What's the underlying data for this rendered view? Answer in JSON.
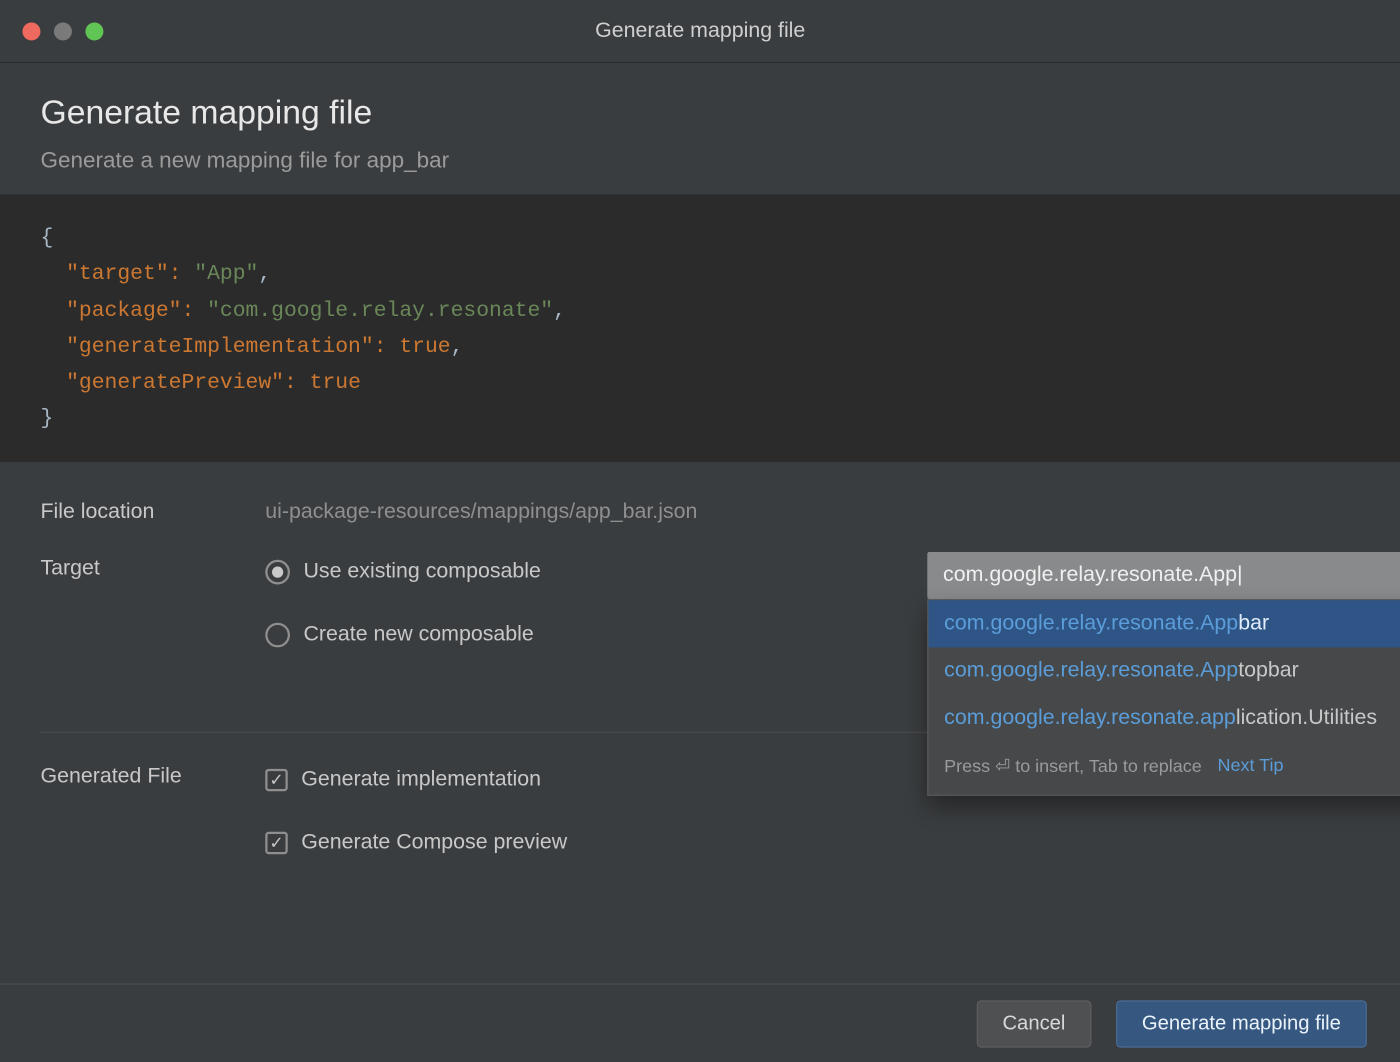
{
  "titlebar": {
    "title": "Generate mapping file"
  },
  "header": {
    "title": "Generate mapping file",
    "subtitle": "Generate a new mapping file for app_bar"
  },
  "code": {
    "open": "{",
    "indent": "  ",
    "k_target": "\"target\"",
    "v_target": "\"App\"",
    "k_package": "\"package\"",
    "v_package": "\"com.google.relay.resonate\"",
    "k_genImpl": "\"generateImplementation\"",
    "v_true1": "true",
    "k_genPrev": "\"generatePreview\"",
    "v_true2": "true",
    "close": "}",
    "comma": ",",
    "colon": ":"
  },
  "form": {
    "file_location_label": "File location",
    "file_location_value": "ui-package-resources/mappings/app_bar.json",
    "target_label": "Target",
    "radio_existing": "Use existing composable",
    "radio_create": "Create new composable",
    "target_input_value": "com.google.relay.resonate.App|",
    "generated_file_label": "Generated File",
    "check_impl": "Generate implementation",
    "check_preview": "Generate Compose preview"
  },
  "autocomplete": {
    "prefix": "com.google.relay.resonate.App",
    "items": [
      {
        "match": "com.google.relay.resonate.App",
        "rest": "bar"
      },
      {
        "match": "com.google.relay.resonate.App",
        "rest": "topbar"
      },
      {
        "match": "com.google.relay.resonate.app",
        "rest": "lication.Utilities"
      }
    ],
    "hint_prefix": "Press ",
    "hint_key": "⏎",
    "hint_mid": " to insert, Tab to replace",
    "next_tip": "Next Tip"
  },
  "footer": {
    "cancel": "Cancel",
    "primary": "Generate mapping file"
  }
}
